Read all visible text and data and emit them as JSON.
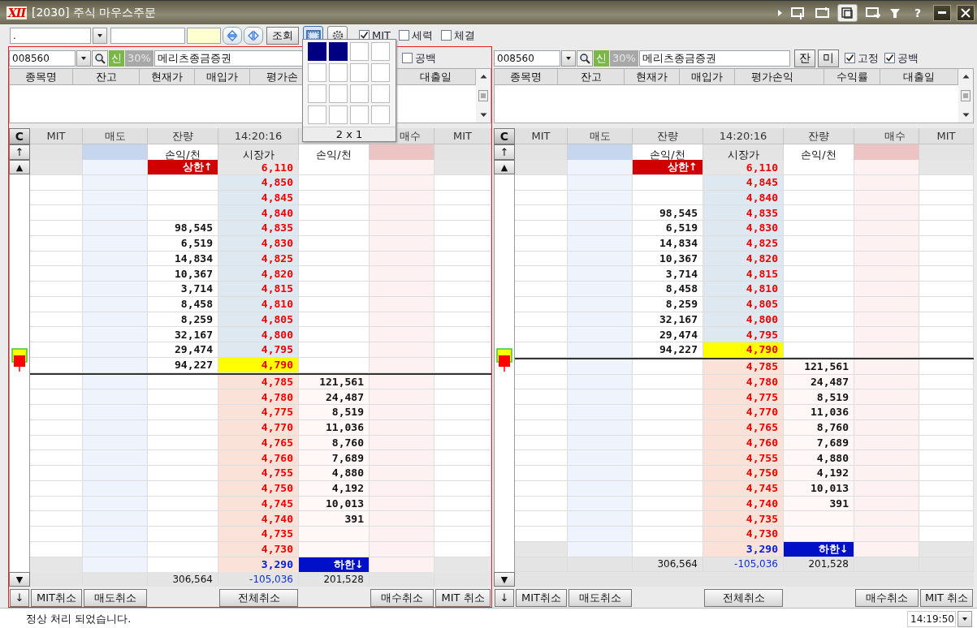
{
  "window": {
    "logo": "XII",
    "title": "[2030] 주식 마우스주문",
    "help": "?"
  },
  "toolbar": {
    "account": ".",
    "query_button": "조회",
    "checkboxes": [
      {
        "label": "MIT",
        "checked": true
      },
      {
        "label": "세력",
        "checked": false
      },
      {
        "label": "체결",
        "checked": false
      }
    ]
  },
  "layout_popup": {
    "grid": [
      [
        {
          "selected": true
        },
        {
          "selected": true
        },
        {
          "selected": false
        },
        {
          "selected": false
        }
      ],
      [
        {
          "selected": false
        },
        {
          "selected": false
        },
        {
          "selected": false
        },
        {
          "selected": false
        }
      ],
      [
        {
          "selected": false
        },
        {
          "selected": false
        },
        {
          "selected": false
        },
        {
          "selected": false
        }
      ],
      [
        {
          "selected": false
        },
        {
          "selected": false
        },
        {
          "selected": false
        },
        {
          "selected": false
        }
      ]
    ],
    "label": "2 x 1"
  },
  "panels": [
    {
      "selected": true,
      "code": "008560",
      "badge": "신",
      "ratio": "30%",
      "name": "메리츠종금증권",
      "checkboxes": [
        {
          "label": "공백",
          "checked": false
        }
      ],
      "holdings_columns": {
        "name": "종목명",
        "balance": "잔고",
        "price": "현재가",
        "cost": "매입가",
        "pnl": "평가손",
        "loan_date": "대출일"
      },
      "book_header": {
        "mit_sell": "MIT",
        "sell": "매도",
        "ask_volume": "잔량",
        "time": "14:20:16",
        "buy": "매수",
        "mit_buy": "MIT"
      },
      "book_subheader": {
        "ask": "손익/천",
        "price": "시장가",
        "bid": "손익/천"
      },
      "strip": {
        "clear": "C",
        "top": "↑",
        "up": "▲",
        "down": "▼"
      },
      "rows": [
        {
          "kind": "upper",
          "price": "6,110",
          "ask": "상한↑"
        },
        {
          "kind": "ask",
          "price": "4,850"
        },
        {
          "kind": "ask",
          "price": "4,845"
        },
        {
          "kind": "ask",
          "price": "4,840"
        },
        {
          "kind": "ask",
          "price": "4,835",
          "ask": "98,545"
        },
        {
          "kind": "ask",
          "price": "4,830",
          "ask": "6,519"
        },
        {
          "kind": "ask",
          "price": "4,825",
          "ask": "14,834"
        },
        {
          "kind": "ask",
          "price": "4,820",
          "ask": "10,367"
        },
        {
          "kind": "ask",
          "price": "4,815",
          "ask": "3,714"
        },
        {
          "kind": "ask",
          "price": "4,810",
          "ask": "8,458"
        },
        {
          "kind": "ask",
          "price": "4,805",
          "ask": "8,259"
        },
        {
          "kind": "ask",
          "price": "4,800",
          "ask": "32,167"
        },
        {
          "kind": "ask",
          "price": "4,795",
          "ask": "29,474"
        },
        {
          "kind": "current",
          "price": "4,790",
          "ask": "94,227"
        },
        {
          "kind": "bid",
          "price": "4,785",
          "bid": "121,561"
        },
        {
          "kind": "bid",
          "price": "4,780",
          "bid": "24,487"
        },
        {
          "kind": "bid",
          "price": "4,775",
          "bid": "8,519"
        },
        {
          "kind": "bid",
          "price": "4,770",
          "bid": "11,036"
        },
        {
          "kind": "bid",
          "price": "4,765",
          "bid": "8,760"
        },
        {
          "kind": "bid",
          "price": "4,760",
          "bid": "7,689"
        },
        {
          "kind": "bid",
          "price": "4,755",
          "bid": "4,880"
        },
        {
          "kind": "bid",
          "price": "4,750",
          "bid": "4,192"
        },
        {
          "kind": "bid",
          "price": "4,745",
          "bid": "10,013"
        },
        {
          "kind": "bid",
          "price": "4,740",
          "bid": "391"
        },
        {
          "kind": "bid",
          "price": "4,735"
        },
        {
          "kind": "bid",
          "price": "4,730"
        },
        {
          "kind": "lower",
          "price": "3,290",
          "bid": "하한↓"
        }
      ],
      "totals": {
        "ask": "306,564",
        "price": "-105,036",
        "bid": "201,528"
      },
      "bottom_buttons": [
        "↓",
        "MIT취소",
        "매도취소",
        "전체취소",
        "매수취소",
        "MIT 취소"
      ]
    },
    {
      "selected": false,
      "code": "008560",
      "badge": "신",
      "ratio": "30%",
      "name": "메리츠종금증권",
      "buttons": [
        "잔",
        "미"
      ],
      "checkboxes": [
        {
          "label": "고정",
          "checked": true
        },
        {
          "label": "공백",
          "checked": true
        }
      ],
      "holdings_columns": {
        "name": "종목명",
        "balance": "잔고",
        "price": "현재가",
        "cost": "매입가",
        "pnl": "평가손익",
        "return": "수익률",
        "loan_date": "대출일"
      },
      "book_header": {
        "mit_sell": "MIT",
        "sell": "매도",
        "ask_volume": "잔량",
        "time": "14:20:16",
        "bid_volume": "잔량",
        "buy": "매수",
        "mit_buy": "MIT"
      },
      "book_subheader": {
        "ask": "손익/천",
        "price": "시장가",
        "bid": "손익/천"
      },
      "strip": {
        "clear": "C",
        "top": "↑",
        "up": "▲",
        "down": "▼"
      },
      "rows": [
        {
          "kind": "upper",
          "price": "6,110",
          "ask": "상한↑"
        },
        {
          "kind": "ask",
          "price": "4,845"
        },
        {
          "kind": "ask",
          "price": "4,840"
        },
        {
          "kind": "ask",
          "price": "4,835",
          "ask": "98,545"
        },
        {
          "kind": "ask",
          "price": "4,830",
          "ask": "6,519"
        },
        {
          "kind": "ask",
          "price": "4,825",
          "ask": "14,834"
        },
        {
          "kind": "ask",
          "price": "4,820",
          "ask": "10,367"
        },
        {
          "kind": "ask",
          "price": "4,815",
          "ask": "3,714"
        },
        {
          "kind": "ask",
          "price": "4,810",
          "ask": "8,458"
        },
        {
          "kind": "ask",
          "price": "4,805",
          "ask": "8,259"
        },
        {
          "kind": "ask",
          "price": "4,800",
          "ask": "32,167"
        },
        {
          "kind": "ask",
          "price": "4,795",
          "ask": "29,474"
        },
        {
          "kind": "current",
          "price": "4,790",
          "ask": "94,227"
        },
        {
          "kind": "bid",
          "price": "4,785",
          "bid": "121,561"
        },
        {
          "kind": "bid",
          "price": "4,780",
          "bid": "24,487"
        },
        {
          "kind": "bid",
          "price": "4,775",
          "bid": "8,519"
        },
        {
          "kind": "bid",
          "price": "4,770",
          "bid": "11,036"
        },
        {
          "kind": "bid",
          "price": "4,765",
          "bid": "8,760"
        },
        {
          "kind": "bid",
          "price": "4,760",
          "bid": "7,689"
        },
        {
          "kind": "bid",
          "price": "4,755",
          "bid": "4,880"
        },
        {
          "kind": "bid",
          "price": "4,750",
          "bid": "4,192"
        },
        {
          "kind": "bid",
          "price": "4,745",
          "bid": "10,013"
        },
        {
          "kind": "bid",
          "price": "4,740",
          "bid": "391"
        },
        {
          "kind": "bid",
          "price": "4,735"
        },
        {
          "kind": "bid",
          "price": "4,730"
        },
        {
          "kind": "lower",
          "price": "3,290",
          "bid": "하한↓"
        }
      ],
      "totals": {
        "ask": "306,564",
        "price": "-105,036",
        "bid": "201,528"
      },
      "bottom_buttons": [
        "↓",
        "MIT취소",
        "매도취소",
        "전체취소",
        "매수취소",
        "MIT 취소"
      ]
    }
  ],
  "status_bar": {
    "message": "정상 처리 되었습니다.",
    "time": "14:19:50"
  }
}
